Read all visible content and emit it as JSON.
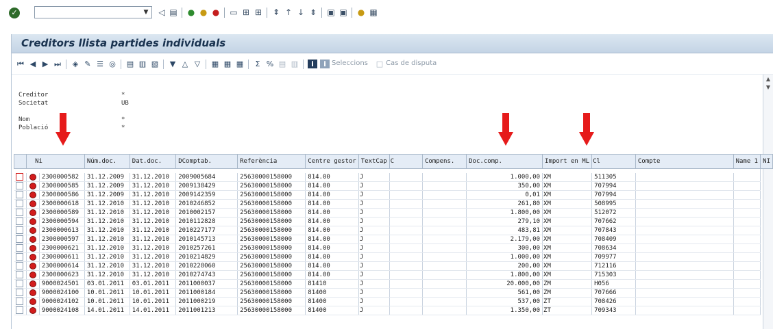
{
  "toolbar": {
    "command_value": "",
    "icons": [
      "enter-icon",
      "back-arrow-icon",
      "save-icon",
      "back-icon",
      "exit-icon",
      "cancel-icon",
      "print-icon",
      "find-icon",
      "find-next-icon",
      "first-page-icon",
      "prev-page-icon",
      "next-page-icon",
      "last-page-icon",
      "new-session-icon",
      "shortcut-icon",
      "help-icon",
      "layout-icon"
    ]
  },
  "window": {
    "title": "Creditors llista partides individuals"
  },
  "app_toolbar": {
    "seleccions_label": "Seleccions",
    "dispute_label": "Cas de disputa"
  },
  "header": {
    "creditor_label": "Creditor",
    "creditor_value": "*",
    "societat_label": "Societat",
    "societat_value": "UB",
    "nom_label": "Nom",
    "nom_value": "*",
    "poblacio_label": "Població",
    "poblacio_value": "*"
  },
  "table": {
    "columns": [
      "Ni",
      "Núm.doc.",
      "Dat.doc.",
      "DComptab.",
      "Referència",
      "Centre gestor",
      "TextCap",
      "C",
      "Compens.",
      "Doc.comp.",
      "Import en ML",
      "Cl",
      "Compte",
      "Name 1",
      "NI"
    ],
    "rows": [
      [
        "2300000582",
        "31.12.2009",
        "31.12.2010",
        "2009005684",
        "25630000158000",
        "814.00",
        "J",
        "",
        "",
        "1.000,00",
        "XM",
        "511305",
        ""
      ],
      [
        "2300000585",
        "31.12.2009",
        "31.12.2010",
        "2009138429",
        "25630000158000",
        "814.00",
        "J",
        "",
        "",
        "350,00",
        "XM",
        "707994",
        ""
      ],
      [
        "2300000586",
        "31.12.2009",
        "31.12.2010",
        "2009142359",
        "25630000158000",
        "814.00",
        "J",
        "",
        "",
        "0,01",
        "XM",
        "707994",
        ""
      ],
      [
        "2300000618",
        "31.12.2010",
        "31.12.2010",
        "2010246852",
        "25630000158000",
        "814.00",
        "J",
        "",
        "",
        "261,80",
        "XM",
        "508995",
        ""
      ],
      [
        "2300000589",
        "31.12.2010",
        "31.12.2010",
        "2010002157",
        "25630000158000",
        "814.00",
        "J",
        "",
        "",
        "1.800,00",
        "XM",
        "512072",
        ""
      ],
      [
        "2300000594",
        "31.12.2010",
        "31.12.2010",
        "2010112828",
        "25630000158000",
        "814.00",
        "J",
        "",
        "",
        "279,10",
        "XM",
        "707662",
        ""
      ],
      [
        "2300000613",
        "31.12.2010",
        "31.12.2010",
        "2010227177",
        "25630000158000",
        "814.00",
        "J",
        "",
        "",
        "483,81",
        "XM",
        "707843",
        ""
      ],
      [
        "2300000597",
        "31.12.2010",
        "31.12.2010",
        "2010145713",
        "25630000158000",
        "814.00",
        "J",
        "",
        "",
        "2.179,00",
        "XM",
        "708409",
        ""
      ],
      [
        "2300000621",
        "31.12.2010",
        "31.12.2010",
        "2010257261",
        "25630000158000",
        "814.00",
        "J",
        "",
        "",
        "300,00",
        "XM",
        "708634",
        ""
      ],
      [
        "2300000611",
        "31.12.2010",
        "31.12.2010",
        "2010214829",
        "25630000158000",
        "814.00",
        "J",
        "",
        "",
        "1.000,00",
        "XM",
        "709977",
        ""
      ],
      [
        "2300000614",
        "31.12.2010",
        "31.12.2010",
        "2010228060",
        "25630000158000",
        "814.00",
        "J",
        "",
        "",
        "200,00",
        "XM",
        "712116",
        ""
      ],
      [
        "2300000623",
        "31.12.2010",
        "31.12.2010",
        "2010274743",
        "25630000158000",
        "814.00",
        "J",
        "",
        "",
        "1.800,00",
        "XM",
        "715303",
        ""
      ],
      [
        "9000024501",
        "03.01.2011",
        "03.01.2011",
        "2011000037",
        "25630000158000",
        "81410",
        "J",
        "",
        "",
        "20.000,00",
        "ZM",
        "H056",
        ""
      ],
      [
        "9000024100",
        "10.01.2011",
        "10.01.2011",
        "2011000184",
        "25630000158000",
        "81400",
        "J",
        "",
        "",
        "561,00",
        "ZM",
        "707666",
        ""
      ],
      [
        "9000024102",
        "10.01.2011",
        "10.01.2011",
        "2011000219",
        "25630000158000",
        "81400",
        "J",
        "",
        "",
        "537,00",
        "ZT",
        "708426",
        ""
      ],
      [
        "9000024108",
        "14.01.2011",
        "14.01.2011",
        "2011001213",
        "25630000158000",
        "81400",
        "J",
        "",
        "",
        "1.350,00",
        "ZT",
        "709343",
        ""
      ]
    ]
  },
  "colors": {
    "status_red": "#d21c1c",
    "header_bg": "#e4ecf6",
    "arrow_red": "#e61b1b"
  }
}
